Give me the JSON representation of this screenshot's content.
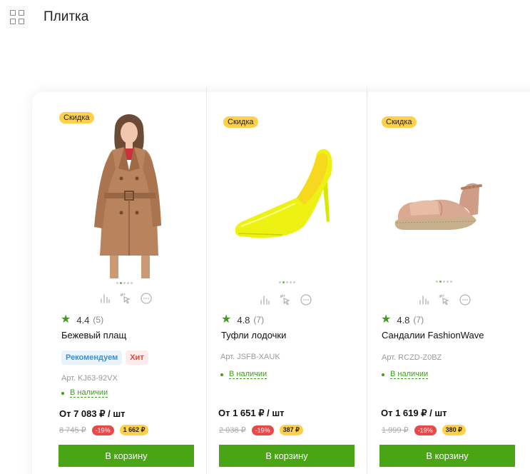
{
  "page": {
    "title": "Плитка"
  },
  "products": [
    {
      "badge": "Скидка",
      "rating": "4.4",
      "reviews": "(5)",
      "name": "Бежевый плащ",
      "tags": [
        "Рекомендуем",
        "Хит"
      ],
      "sku": "Арт. KJ63-92VX",
      "stock": "В наличии",
      "price": "От 7 083 ₽ / шт",
      "old_price": "8 745 ₽",
      "discount": "-19%",
      "bonus": "1 662 ₽",
      "button": "В корзину",
      "image": "beige-coat-photo"
    },
    {
      "badge": "Скидка",
      "rating": "4.8",
      "reviews": "(7)",
      "name": "Туфли лодочки",
      "sku": "Арт. JSFB-XAUK",
      "stock": "В наличии",
      "price": "От 1 651 ₽ / шт",
      "old_price": "2 038 ₽",
      "discount": "-19%",
      "bonus": "387 ₽",
      "button": "В корзину",
      "image": "yellow-pump-photo"
    },
    {
      "badge": "Скидка",
      "rating": "4.8",
      "reviews": "(7)",
      "name": "Сандалии FashionWave",
      "sku": "Арт. RCZD-Z0BZ",
      "stock": "В наличии",
      "price": "От 1 619 ₽ / шт",
      "old_price": "1 999 ₽",
      "discount": "-19%",
      "bonus": "380 ₽",
      "button": "В корзину",
      "image": "rose-gold-espadrille-photo"
    }
  ],
  "icons": [
    "grid-view-icon",
    "compare-icon",
    "quick-view-icon",
    "more-icon",
    "star-icon"
  ],
  "colors": {
    "accent": "#4aa514",
    "sale": "#ffd04a",
    "discount": "#e84a4a",
    "recommend": "#3c8fd0",
    "hit": "#e0473a"
  }
}
